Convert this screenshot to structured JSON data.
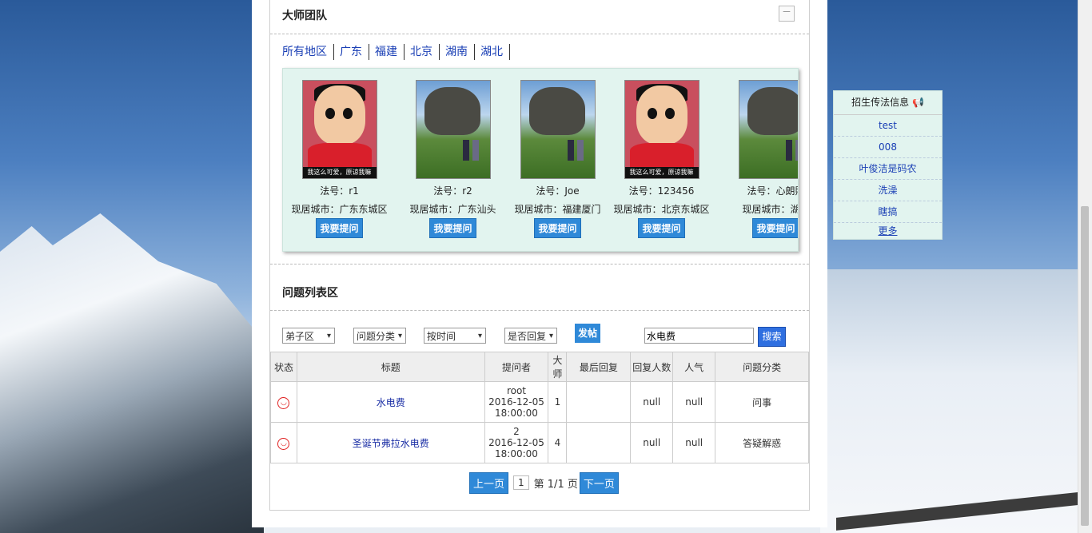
{
  "master_team": {
    "title": "大师团队",
    "collapse_symbol": "－",
    "regions": [
      "所有地区",
      "广东",
      "福建",
      "北京",
      "湖南",
      "湖北"
    ],
    "masters": [
      {
        "image": "crayon-shinchan",
        "image_caption": "我这么可爱，原谅我嘛",
        "name_line": "法号：r1",
        "city_line": "现居城市：广东东城区",
        "button": "我要提问"
      },
      {
        "image": "howls-moving-castle",
        "name_line": "法号：r2",
        "city_line": "现居城市：广东汕头",
        "button": "我要提问"
      },
      {
        "image": "howls-moving-castle",
        "name_line": "法号：Joe",
        "city_line": "现居城市：福建厦门",
        "button": "我要提问"
      },
      {
        "image": "crayon-shinchan",
        "image_caption": "我这么可爱，原谅我嘛",
        "name_line": "法号：123456",
        "city_line": "现居城市：北京东城区",
        "button": "我要提问"
      },
      {
        "image": "howls-moving-castle",
        "name_line": "法号：心朗照",
        "city_line": "现居城市：湖南",
        "button": "我要提问"
      }
    ]
  },
  "questions": {
    "title": "问题列表区",
    "filters": {
      "area": "弟子区",
      "category": "问题分类",
      "sort": "按时间",
      "replied": "是否回复"
    },
    "post_button": "发帖",
    "search_value": "水电费",
    "search_button": "搜索",
    "columns": [
      "状态",
      "标题",
      "提问者",
      "大师",
      "最后回复",
      "回复人数",
      "人气",
      "问题分类"
    ],
    "rows": [
      {
        "status_icon": "smile-icon",
        "title": "水电费",
        "asker": "root",
        "date": "2016-12-05",
        "time": "18:00:00",
        "master": "1",
        "last_reply": "",
        "reply_count": "null",
        "popularity": "null",
        "category": "问事"
      },
      {
        "status_icon": "smile-icon",
        "title": "圣诞节弗拉水电费",
        "asker": "2",
        "date": "2016-12-05",
        "time": "18:00:00",
        "master": "4",
        "last_reply": "",
        "reply_count": "null",
        "popularity": "null",
        "category": "答疑解惑"
      }
    ],
    "pager": {
      "prev": "上一页",
      "current": "1",
      "info": "第 1/1 页",
      "next": "下一页"
    }
  },
  "notice": {
    "title": "招生传法信息",
    "icon": "megaphone-icon",
    "items": [
      "test",
      "008",
      "叶俊洁是码农",
      "洗澡",
      "瞎搞"
    ],
    "more": "更多"
  },
  "colors": {
    "accent": "#2f89d8",
    "panel_bg": "#e2f4ef",
    "link": "#1a3fb5"
  }
}
